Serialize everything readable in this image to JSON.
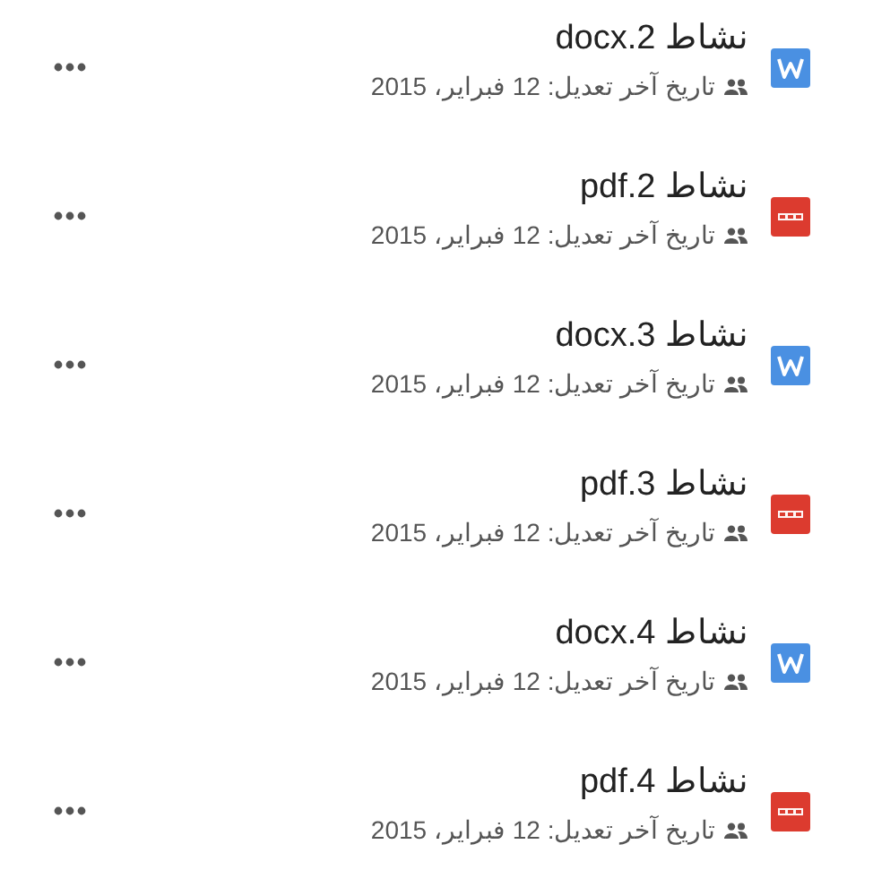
{
  "files": [
    {
      "kind": "word",
      "name": "نشاط 2.docx",
      "modified": "تاريخ آخر تعديل: 12 فبراير، 2015"
    },
    {
      "kind": "pdf",
      "name": "نشاط 2.pdf",
      "modified": "تاريخ آخر تعديل: 12 فبراير، 2015"
    },
    {
      "kind": "word",
      "name": "نشاط 3.docx",
      "modified": "تاريخ آخر تعديل: 12 فبراير، 2015"
    },
    {
      "kind": "pdf",
      "name": "نشاط 3.pdf",
      "modified": "تاريخ آخر تعديل: 12 فبراير، 2015"
    },
    {
      "kind": "word",
      "name": "نشاط 4.docx",
      "modified": "تاريخ آخر تعديل: 12 فبراير، 2015"
    },
    {
      "kind": "pdf",
      "name": "نشاط 4.pdf",
      "modified": "تاريخ آخر تعديل: 12 فبراير، 2015"
    }
  ]
}
